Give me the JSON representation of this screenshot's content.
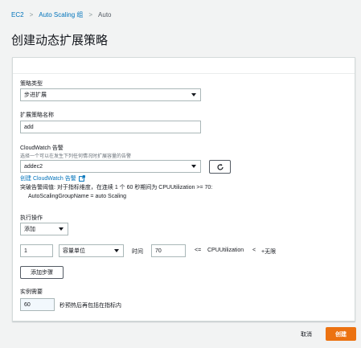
{
  "breadcrumb": {
    "items": [
      "EC2",
      "Auto Scaling 组",
      "Auto"
    ],
    "separator": ">"
  },
  "page_title": "创建动态扩展策略",
  "form": {
    "policy_type": {
      "label": "策略类型",
      "value": "步进扩展"
    },
    "policy_name": {
      "label": "扩展策略名称",
      "value": "add"
    },
    "cloudwatch": {
      "label": "CloudWatch 告警",
      "hint": "选择一个可以在发生下列任何情况时扩展容量的告警",
      "value": "addec2",
      "create_link": "创建 CloudWatch 告警",
      "threshold_text": "突破告警阈值: 对于指标维度，在连续 1 个 60 秒期间为 CPUUtilization >= 70:",
      "dimension_text": "AutoScalingGroupName = auto Scaling"
    },
    "action": {
      "label": "执行操作",
      "value": "添加"
    },
    "step": {
      "quantity": "1",
      "unit": "容量单位",
      "time_label": "时间",
      "lower_bound": "70",
      "op_le": "<=",
      "metric": "CPUUtilization",
      "op_lt": "<",
      "upper_bound": "+无限"
    },
    "add_step_label": "添加步骤",
    "warmup": {
      "label": "实例需要",
      "value": "60",
      "suffix": "秒预热后再包括在指标内"
    }
  },
  "footer": {
    "cancel_label": "取消",
    "create_label": "创建"
  },
  "colors": {
    "link": "#0073bb",
    "primary": "#ec7211",
    "background": "#f2f3f3"
  },
  "icons": {
    "refresh": "refresh-icon",
    "external": "external-link-icon"
  }
}
